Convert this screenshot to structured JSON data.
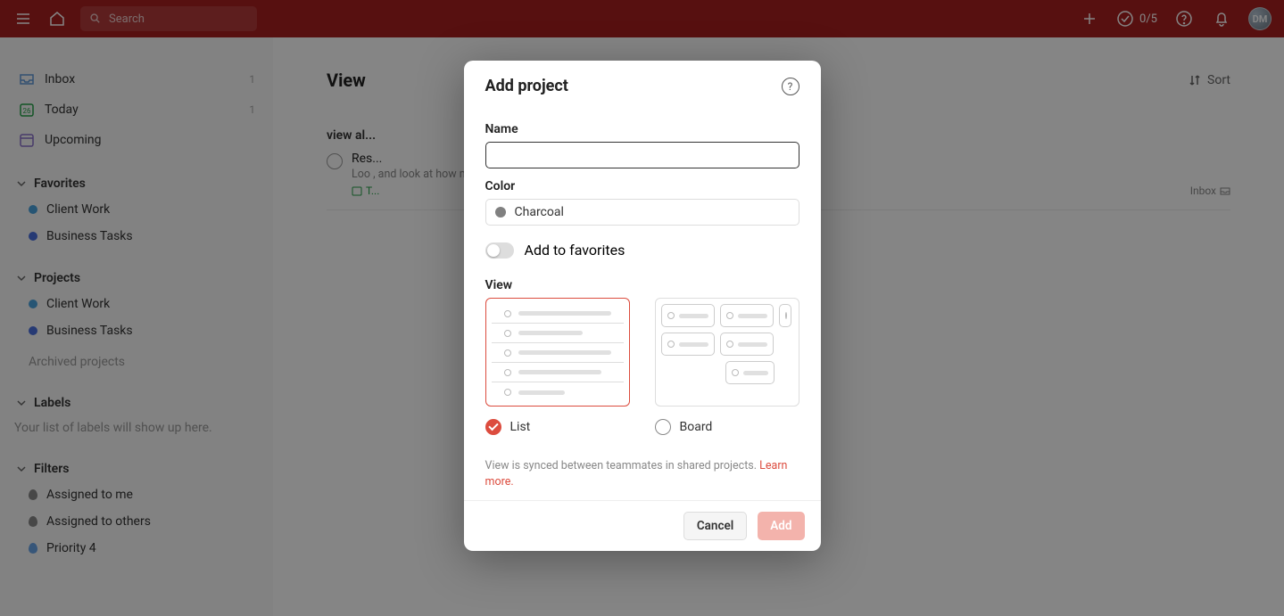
{
  "topbar": {
    "search_placeholder": "Search",
    "counter": "0/5",
    "avatar_initials": "DM"
  },
  "sidebar": {
    "inbox": {
      "label": "Inbox",
      "count": "1"
    },
    "today": {
      "label": "Today",
      "count": "1",
      "date_badge": "26"
    },
    "upcoming": {
      "label": "Upcoming"
    },
    "favorites_header": "Favorites",
    "favorites": [
      {
        "label": "Client Work",
        "color": "#4aa3df"
      },
      {
        "label": "Business Tasks",
        "color": "#4a6fdf"
      }
    ],
    "projects_header": "Projects",
    "projects": [
      {
        "label": "Client Work",
        "color": "#4aa3df"
      },
      {
        "label": "Business Tasks",
        "color": "#4a6fdf"
      }
    ],
    "archived_label": "Archived projects",
    "labels_header": "Labels",
    "labels_empty": "Your list of labels will show up here.",
    "filters_header": "Filters",
    "filters": [
      {
        "label": "Assigned to me",
        "color": "#888"
      },
      {
        "label": "Assigned to others",
        "color": "#888"
      },
      {
        "label": "Priority 4",
        "color": "#6aa5e9"
      }
    ]
  },
  "main": {
    "title": "View",
    "sort_label": "Sort",
    "section_name": "view al...",
    "task": {
      "title": "Res...",
      "desc": "Loo                                                                                                                                                 , and look at how much flights to each airport will cost ...",
      "date": "T...",
      "project": "Inbox "
    }
  },
  "modal": {
    "title": "Add project",
    "name_label": "Name",
    "name_value": "",
    "color_label": "Color",
    "color_value": "Charcoal",
    "color_hex": "#808080",
    "favorite_label": "Add to favorites",
    "favorite_on": false,
    "view_label": "View",
    "view_list": "List",
    "view_board": "Board",
    "view_selected": "list",
    "sync_note_prefix": "View is synced between teammates in shared projects. ",
    "sync_note_link": "Learn more.",
    "cancel_label": "Cancel",
    "add_label": "Add"
  }
}
